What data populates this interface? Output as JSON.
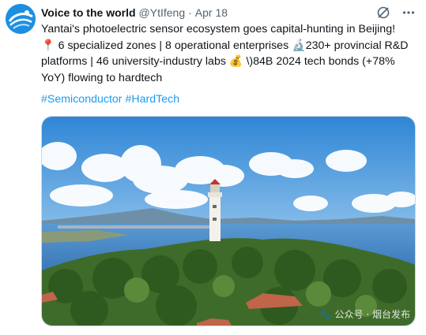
{
  "tweet": {
    "author_name": "Voice to the world",
    "handle": "@YtIfeng",
    "separator": "·",
    "date": "Apr 18",
    "text_lines": [
      "Yantai's photoelectric sensor ecosystem goes capital-hunting in Beijing!",
      "📍 6 specialized zones | 8 operational enterprises 🔬230+ provincial R&D",
      "platforms | 46 university-industry labs 💰 \\)84B 2024 tech bonds (+78%",
      "YoY) flowing to hardtech"
    ],
    "hashtags": [
      "#Semiconductor",
      "#HardTech"
    ],
    "image_watermark": "🐾 公众号 · 烟台发布"
  },
  "icons": {
    "avatar": "globe-logo-icon",
    "grok": "grok-icon",
    "more": "more-icon"
  },
  "colors": {
    "link": "#1d9bf0",
    "secondary_text": "#536471",
    "avatar_bg": "#1d8fe0",
    "sky": "#3f8fd8",
    "sea": "#4a86c8",
    "foliage": "#3f6b2a"
  }
}
